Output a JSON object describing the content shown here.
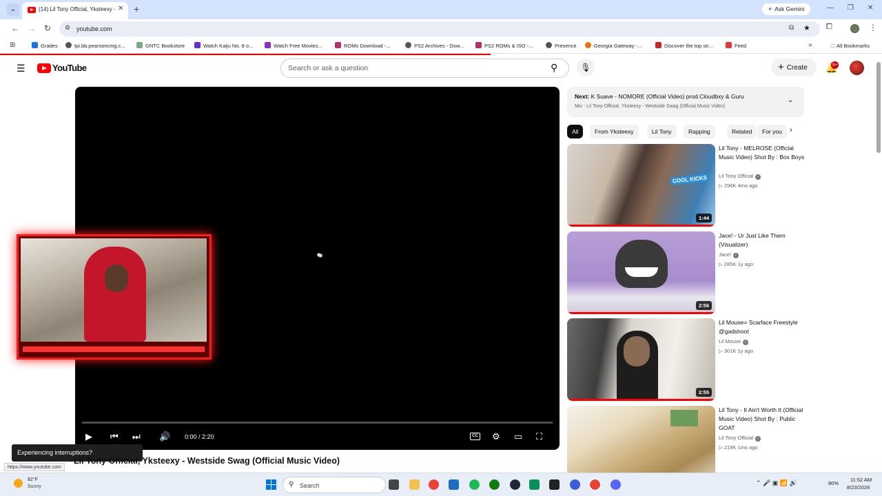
{
  "browser": {
    "tab_title": "(14) Lil Tony Official, Yksteexy - ...",
    "ask_gemini": "Ask Gemini",
    "url": "youtube.com",
    "bookmarks": [
      "Grades",
      "tpi.bb.pearsoncmg.c...",
      "GNTC Bookstore",
      "Watch Kaiju No. 8 o...",
      "Watch Free Movies...",
      "ROMs Download -...",
      "PS2 Archives - Dow...",
      "PS2 ROMs & ISO -...",
      "Presence",
      "Georgia Gateway -...",
      "Discover the top str...",
      "Feed"
    ],
    "all_bookmarks": "All Bookmarks",
    "status_url": "https://www.youtube.com"
  },
  "youtube": {
    "wordmark": "YouTube",
    "search_placeholder": "Search or ask a question",
    "create_label": "Create",
    "notification_count": "9+"
  },
  "player": {
    "time": "0:00 / 2:20",
    "progress": 0,
    "cc_label": "CC",
    "toast": "Experiencing interruptions?",
    "video_title": "Lil Tony Official, Yksteexy - Westside Swag (Official Music Video)"
  },
  "up_next": {
    "prefix": "Next:",
    "title": "K Suave - NOMORE (Official Video) prod.Cloudbxy & Guru",
    "subtitle": "Mix - Lil Tony Official, Yksteexy - Westside Swag (Official Music Video)"
  },
  "chips": [
    "All",
    "From Yksteexy",
    "Lil Tony",
    "Rapping",
    "Related",
    "For you"
  ],
  "recommendations": [
    {
      "title": "Lil Tony - MELROSE (Official Music Video) Shot By : Box Boys",
      "channel": "Lil Tony Official",
      "views": "296K",
      "age": "4mo ago",
      "duration": "1:44",
      "thumb_overlay": "COOL KICKS"
    },
    {
      "title": "Jace! - Ur Just Like Them (Visualizer)",
      "channel": "Jace!",
      "views": "285K",
      "age": "1y ago",
      "duration": "2:56"
    },
    {
      "title": "Lil Mouse= Scarface Freestyle @gadshoot",
      "channel": "Lil Mouse",
      "views": "301K",
      "age": "1y ago",
      "duration": "2:55"
    },
    {
      "title": "Lil Tony - It Ain't Worth It (Official Music Video) Shot By : Public GOAT",
      "channel": "Lil Tony Official",
      "views": "219K",
      "age": "1mo ago",
      "duration": ""
    }
  ],
  "taskbar": {
    "temp": "82°F",
    "condition": "Sunny",
    "search_label": "Search",
    "battery": "80%",
    "time": "11:52 AM",
    "date": "8/23/2026"
  }
}
